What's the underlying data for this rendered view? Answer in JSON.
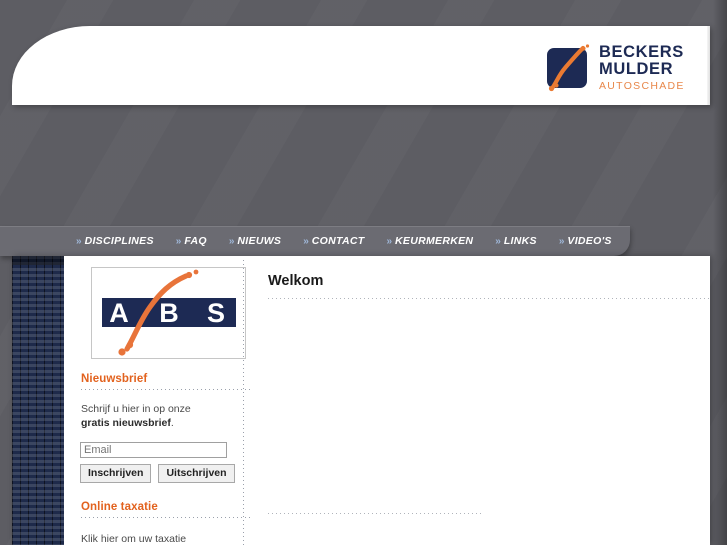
{
  "brand": {
    "line1": "BECKERS",
    "line2": "MULDER",
    "line3": "AUTOSCHADE",
    "mark_icon": "abs-swoosh-icon",
    "navy": "#1d2a54",
    "orange": "#e8874a"
  },
  "nav": {
    "chevron": "»",
    "items": [
      {
        "label": "DISCIPLINES"
      },
      {
        "label": "FAQ"
      },
      {
        "label": "NIEUWS"
      },
      {
        "label": "CONTACT"
      },
      {
        "label": "KEURMERKEN"
      },
      {
        "label": "LINKS"
      },
      {
        "label": "VIDEO'S"
      }
    ]
  },
  "sidebar": {
    "logo": {
      "icon": "abs-logo",
      "letters": [
        "A",
        "B",
        "S"
      ],
      "navy": "#1d2a54",
      "orange": "#e8743a"
    },
    "newsletter": {
      "heading": "Nieuwsbrief",
      "intro_line1": "Schrijf u hier in op onze",
      "intro_bold": "gratis nieuwsbrief",
      "intro_period": ".",
      "email_placeholder": "Email",
      "email_value": "",
      "subscribe_label": "Inschrijven",
      "unsubscribe_label": "Uitschrijven"
    },
    "taxatie": {
      "heading": "Online taxatie",
      "text": "Klik hier om uw taxatie"
    },
    "heading_color": "#e2621e"
  },
  "main": {
    "title": "Welkom",
    "body": ""
  }
}
